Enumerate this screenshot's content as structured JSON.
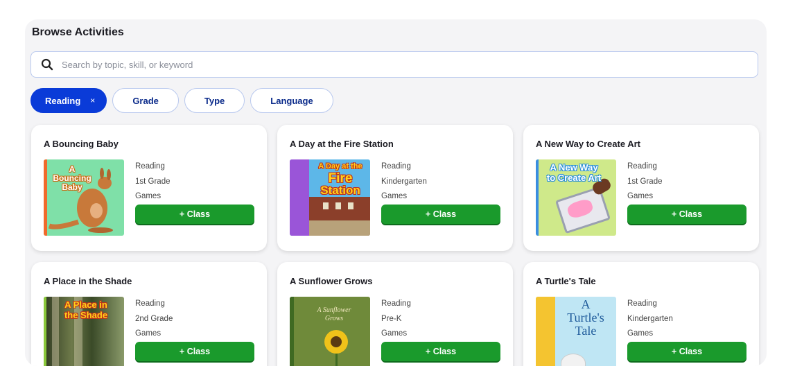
{
  "header": {
    "title": "Browse Activities"
  },
  "search": {
    "placeholder": "Search by topic, skill, or keyword"
  },
  "filters": [
    {
      "label": "Reading",
      "active": true,
      "remove_glyph": "×"
    },
    {
      "label": "Grade"
    },
    {
      "label": "Type"
    },
    {
      "label": "Language"
    }
  ],
  "activities": [
    {
      "title": "A Bouncing Baby",
      "subject": "Reading",
      "grade": "1st Grade",
      "type": "Games",
      "button": "+ Class",
      "cover_text": [
        "A",
        "Bouncing",
        "Baby"
      ]
    },
    {
      "title": "A Day at the Fire Station",
      "subject": "Reading",
      "grade": "Kindergarten",
      "type": "Games",
      "button": "+ Class",
      "cover_text": [
        "A Day at the",
        "Fire",
        "Station"
      ]
    },
    {
      "title": "A New Way to Create Art",
      "subject": "Reading",
      "grade": "1st Grade",
      "type": "Games",
      "button": "+ Class",
      "cover_text": [
        "A New Way",
        "to Create Art"
      ]
    },
    {
      "title": "A Place in the Shade",
      "subject": "Reading",
      "grade": "2nd Grade",
      "type": "Games",
      "button": "+ Class",
      "cover_text": [
        "A Place in",
        "the Shade"
      ]
    },
    {
      "title": "A Sunflower Grows",
      "subject": "Reading",
      "grade": "Pre-K",
      "type": "Games",
      "button": "+ Class",
      "cover_text": [
        "A Sunflower",
        "Grows"
      ]
    },
    {
      "title": "A Turtle's Tale",
      "subject": "Reading",
      "grade": "Kindergarten",
      "type": "Games",
      "button": "+ Class",
      "cover_text": [
        "A",
        "Turtle's",
        "Tale"
      ]
    }
  ],
  "colors": {
    "accent": "#0a3bd8",
    "button": "#1a9a2c",
    "panel": "#f4f4f6"
  }
}
